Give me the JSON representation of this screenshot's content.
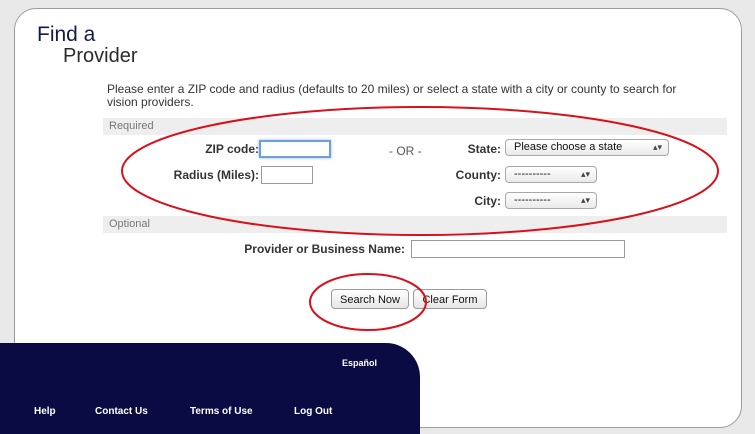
{
  "page": {
    "title_line1": "Find a",
    "title_line2": "Provider",
    "intro": "Please enter a ZIP code and radius (defaults to 20 miles) or select a state with a city or county to search for vision providers."
  },
  "required_section": {
    "label": "Required",
    "zip_label": "ZIP code:",
    "zip_value": "",
    "radius_label": "Radius (Miles):",
    "radius_value": "",
    "or_text": "- OR -",
    "state_label": "State:",
    "state_selected": "Please choose a state",
    "county_label": "County:",
    "county_selected": "----------",
    "city_label": "City:",
    "city_selected": "----------"
  },
  "optional_section": {
    "label": "Optional",
    "provider_label": "Provider or Business Name:",
    "provider_value": ""
  },
  "actions": {
    "search_label": "Search Now",
    "clear_label": "Clear Form"
  },
  "footer": {
    "language_link": "Español",
    "links": [
      "Help",
      "Contact Us",
      "Terms of Use",
      "Log Out"
    ]
  },
  "colors": {
    "annotation": "#d8101c",
    "footer_bg": "#0b0b43",
    "title": "#101a4e"
  },
  "icons": {
    "select_arrow": "up-down-chevron-icon"
  }
}
